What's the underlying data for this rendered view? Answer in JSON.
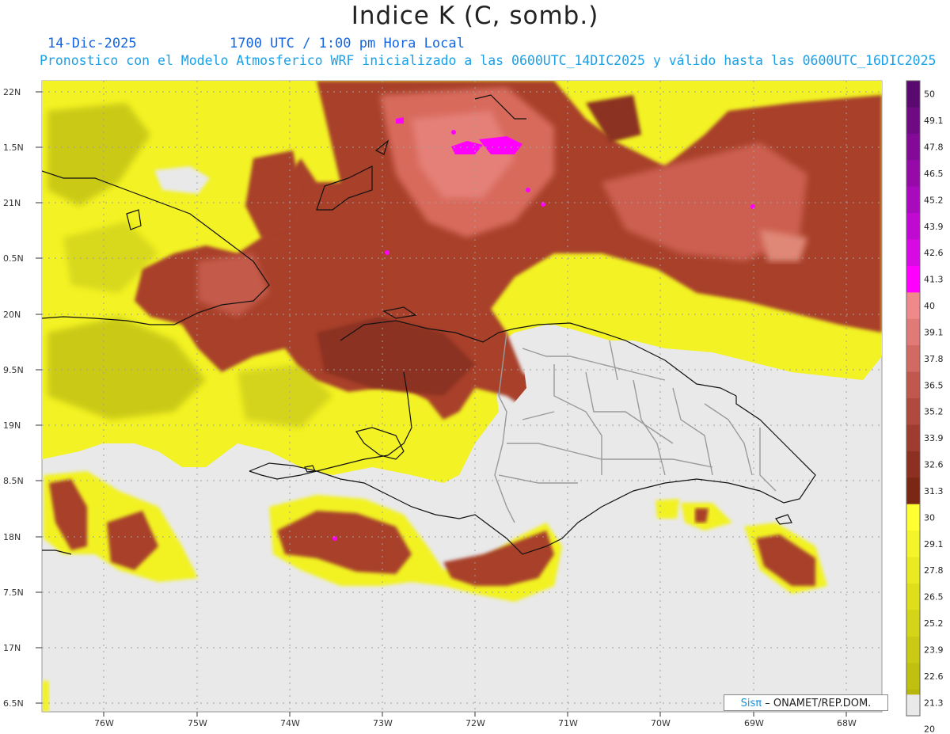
{
  "title": "Indice K (C, somb.)",
  "date": "14-Dic-2025",
  "time": "1700 UTC / 1:00 pm Hora Local",
  "subtitle": "Pronostico con el Modelo Atmosferico WRF inicializado a las 0600UTC_14DIC2025 y válido hasta las  0600UTC_16DIC2025",
  "credit": {
    "brand": "Sisπ",
    "text": "– ONAMET/REP.DOM."
  },
  "lat_labels": [
    "22N",
    "1.5N",
    "21N",
    "0.5N",
    "20N",
    "9.5N",
    "19N",
    "8.5N",
    "18N",
    "7.5N",
    "17N",
    "6.5N"
  ],
  "lon_labels": [
    "76W",
    "75W",
    "74W",
    "73W",
    "72W",
    "71W",
    "70W",
    "69W",
    "68W"
  ],
  "colorbar": {
    "labels": [
      "50",
      "49.1",
      "47.8",
      "46.5",
      "45.2",
      "43.9",
      "42.6",
      "41.3",
      "40",
      "39.1",
      "37.8",
      "36.5",
      "35.2",
      "33.9",
      "32.6",
      "31.3",
      "30",
      "29.1",
      "27.8",
      "26.5",
      "25.2",
      "23.9",
      "22.6",
      "21.3",
      "20"
    ],
    "colors": {
      "top": [
        "#5a0a6e",
        "#6e0a82",
        "#820a96",
        "#960aaa",
        "#aa0abe",
        "#c00ad2",
        "#d80ae4",
        "#ff00ff"
      ],
      "mid": [
        "#f08a8a",
        "#e07a76",
        "#d06a62",
        "#c0584e",
        "#b04a3e",
        "#9e3c30",
        "#8c3022",
        "#7a2814"
      ],
      "low": [
        "#ffff33",
        "#f4f42a",
        "#eaea22",
        "#dede1c",
        "#d4d418",
        "#caca14",
        "#c0c010",
        "#b6b60c"
      ]
    }
  },
  "field_colors": {
    "background": "#e9e9e9",
    "land": "#e9e9e9",
    "yellow_light": "#f5f52a",
    "yellow_dark": "#c8c818",
    "brown": "#a84430",
    "brown_dark": "#8a3220",
    "pink": "#e08080",
    "magenta": "#ff00ff"
  }
}
